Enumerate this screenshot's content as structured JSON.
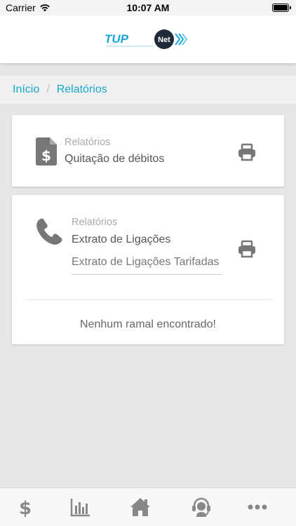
{
  "status_bar": {
    "carrier": "Carrier",
    "time": "10:07 AM"
  },
  "header": {
    "logo_text_left": "TUP",
    "logo_text_badge": "Net"
  },
  "breadcrumb": {
    "home": "Início",
    "separator": "/",
    "current": "Relatórios"
  },
  "card_debts": {
    "category": "Relatórios",
    "title": "Quitação de débitos",
    "icon": "dollar-document-icon"
  },
  "card_calls": {
    "category": "Relatórios",
    "title": "Extrato de Ligações",
    "select_value": "Extrato de Ligações Tarifadas",
    "empty_message": "Nenhum ramal encontrado!",
    "icon": "phone-icon"
  },
  "tabbar": {
    "items": [
      "dollar-icon",
      "bar-chart-icon",
      "home-icon",
      "headset-icon",
      "more-icon"
    ]
  },
  "colors": {
    "accent": "#17a7c9",
    "icon_gray": "#777777",
    "background": "#e6e6e6"
  }
}
